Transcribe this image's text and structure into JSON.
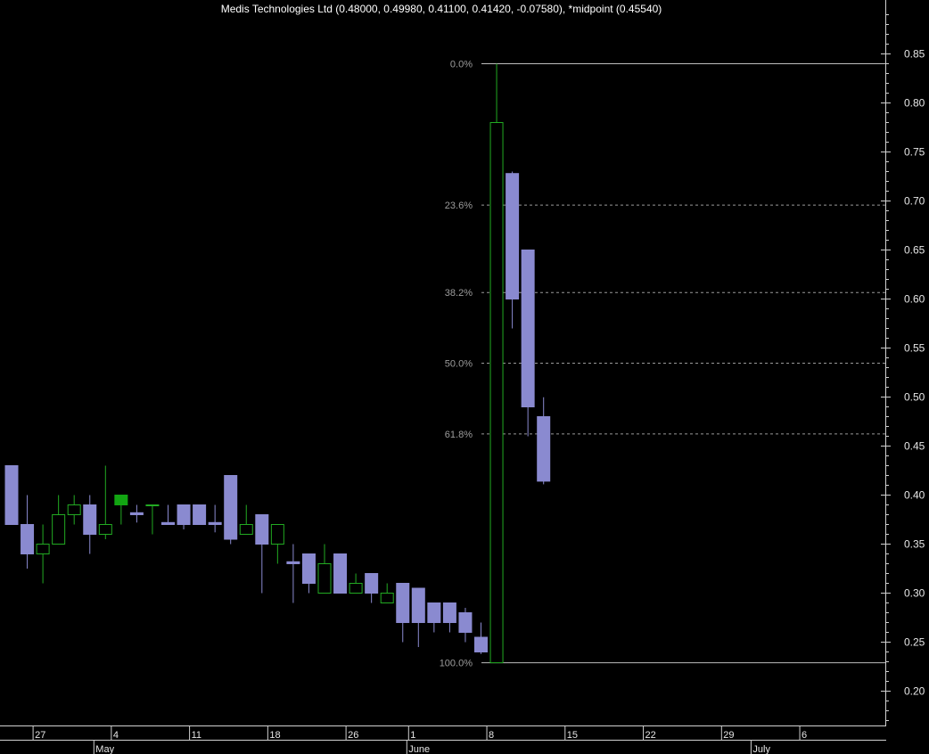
{
  "chart_data": {
    "type": "candlestick",
    "title": "Medis Technologies Ltd (0.48000, 0.49980, 0.41100, 0.41420, -0.07580), *midpoint (0.45540)",
    "ylim": [
      0.165,
      0.905
    ],
    "y_ticks": [
      "0.20",
      "0.25",
      "0.30",
      "0.35",
      "0.40",
      "0.45",
      "0.50",
      "0.55",
      "0.60",
      "0.65",
      "0.70",
      "0.75",
      "0.80",
      "0.85"
    ],
    "x_day_labels": [
      {
        "label": "27",
        "col": 2
      },
      {
        "label": "4",
        "col": 7
      },
      {
        "label": "11",
        "col": 12
      },
      {
        "label": "18",
        "col": 17
      },
      {
        "label": "26",
        "col": 22
      },
      {
        "label": "1",
        "col": 26
      },
      {
        "label": "8",
        "col": 31
      },
      {
        "label": "15",
        "col": 36
      },
      {
        "label": "22",
        "col": 41
      },
      {
        "label": "29",
        "col": 46
      },
      {
        "label": "6",
        "col": 51
      }
    ],
    "x_month_labels": [
      {
        "label": "May",
        "col": 6
      },
      {
        "label": "June",
        "col": 26
      },
      {
        "label": "July",
        "col": 48
      }
    ],
    "fibonacci": {
      "high": 0.84,
      "low": 0.229,
      "levels": [
        {
          "label": "0.0%",
          "value": 0.84,
          "style": "solid"
        },
        {
          "label": "23.6%",
          "value": 0.6958,
          "style": "dashed"
        },
        {
          "label": "38.2%",
          "value": 0.6066,
          "style": "dashed"
        },
        {
          "label": "50.0%",
          "value": 0.5345,
          "style": "dashed"
        },
        {
          "label": "61.8%",
          "value": 0.4624,
          "style": "dashed"
        },
        {
          "label": "100.0%",
          "value": 0.229,
          "style": "solid"
        }
      ]
    },
    "candles": [
      {
        "col": 0,
        "o": 0.43,
        "h": 0.43,
        "l": 0.37,
        "c": 0.37
      },
      {
        "col": 1,
        "o": 0.37,
        "h": 0.4,
        "l": 0.325,
        "c": 0.34
      },
      {
        "col": 2,
        "o": 0.34,
        "h": 0.37,
        "l": 0.31,
        "c": 0.35
      },
      {
        "col": 3,
        "o": 0.35,
        "h": 0.4,
        "l": 0.35,
        "c": 0.38
      },
      {
        "col": 4,
        "o": 0.38,
        "h": 0.4,
        "l": 0.37,
        "c": 0.39
      },
      {
        "col": 5,
        "o": 0.39,
        "h": 0.4,
        "l": 0.34,
        "c": 0.36
      },
      {
        "col": 6,
        "o": 0.36,
        "h": 0.43,
        "l": 0.355,
        "c": 0.37
      },
      {
        "col": 7,
        "o": 0.39,
        "h": 0.4,
        "l": 0.37,
        "c": 0.4,
        "filled": true
      },
      {
        "col": 8,
        "o": 0.382,
        "h": 0.39,
        "l": 0.372,
        "c": 0.38
      },
      {
        "col": 9,
        "o": 0.39,
        "h": 0.39,
        "l": 0.36,
        "c": 0.39
      },
      {
        "col": 10,
        "o": 0.372,
        "h": 0.39,
        "l": 0.37,
        "c": 0.37
      },
      {
        "col": 11,
        "o": 0.39,
        "h": 0.39,
        "l": 0.365,
        "c": 0.37
      },
      {
        "col": 12,
        "o": 0.39,
        "h": 0.39,
        "l": 0.37,
        "c": 0.37
      },
      {
        "col": 13,
        "o": 0.372,
        "h": 0.39,
        "l": 0.362,
        "c": 0.37
      },
      {
        "col": 14,
        "o": 0.42,
        "h": 0.42,
        "l": 0.35,
        "c": 0.355
      },
      {
        "col": 15,
        "o": 0.36,
        "h": 0.39,
        "l": 0.36,
        "c": 0.37
      },
      {
        "col": 16,
        "o": 0.38,
        "h": 0.38,
        "l": 0.3,
        "c": 0.35
      },
      {
        "col": 17,
        "o": 0.35,
        "h": 0.37,
        "l": 0.33,
        "c": 0.37
      },
      {
        "col": 18,
        "o": 0.332,
        "h": 0.35,
        "l": 0.29,
        "c": 0.33
      },
      {
        "col": 19,
        "o": 0.34,
        "h": 0.34,
        "l": 0.3,
        "c": 0.31
      },
      {
        "col": 20,
        "o": 0.3,
        "h": 0.35,
        "l": 0.3,
        "c": 0.33
      },
      {
        "col": 21,
        "o": 0.34,
        "h": 0.34,
        "l": 0.3,
        "c": 0.3
      },
      {
        "col": 22,
        "o": 0.3,
        "h": 0.32,
        "l": 0.3,
        "c": 0.31
      },
      {
        "col": 23,
        "o": 0.32,
        "h": 0.32,
        "l": 0.29,
        "c": 0.3
      },
      {
        "col": 24,
        "o": 0.29,
        "h": 0.31,
        "l": 0.29,
        "c": 0.3
      },
      {
        "col": 25,
        "o": 0.31,
        "h": 0.31,
        "l": 0.25,
        "c": 0.27
      },
      {
        "col": 26,
        "o": 0.305,
        "h": 0.305,
        "l": 0.245,
        "c": 0.27
      },
      {
        "col": 27,
        "o": 0.29,
        "h": 0.29,
        "l": 0.26,
        "c": 0.27
      },
      {
        "col": 28,
        "o": 0.29,
        "h": 0.29,
        "l": 0.26,
        "c": 0.27
      },
      {
        "col": 29,
        "o": 0.28,
        "h": 0.285,
        "l": 0.25,
        "c": 0.26
      },
      {
        "col": 30,
        "o": 0.255,
        "h": 0.27,
        "l": 0.238,
        "c": 0.24
      },
      {
        "col": 31,
        "o": 0.229,
        "h": 0.84,
        "l": 0.229,
        "c": 0.78
      },
      {
        "col": 32,
        "o": 0.728,
        "h": 0.73,
        "l": 0.57,
        "c": 0.6
      },
      {
        "col": 33,
        "o": 0.65,
        "h": 0.65,
        "l": 0.46,
        "c": 0.49
      },
      {
        "col": 34,
        "o": 0.48,
        "h": 0.4998,
        "l": 0.411,
        "c": 0.4142
      }
    ]
  }
}
